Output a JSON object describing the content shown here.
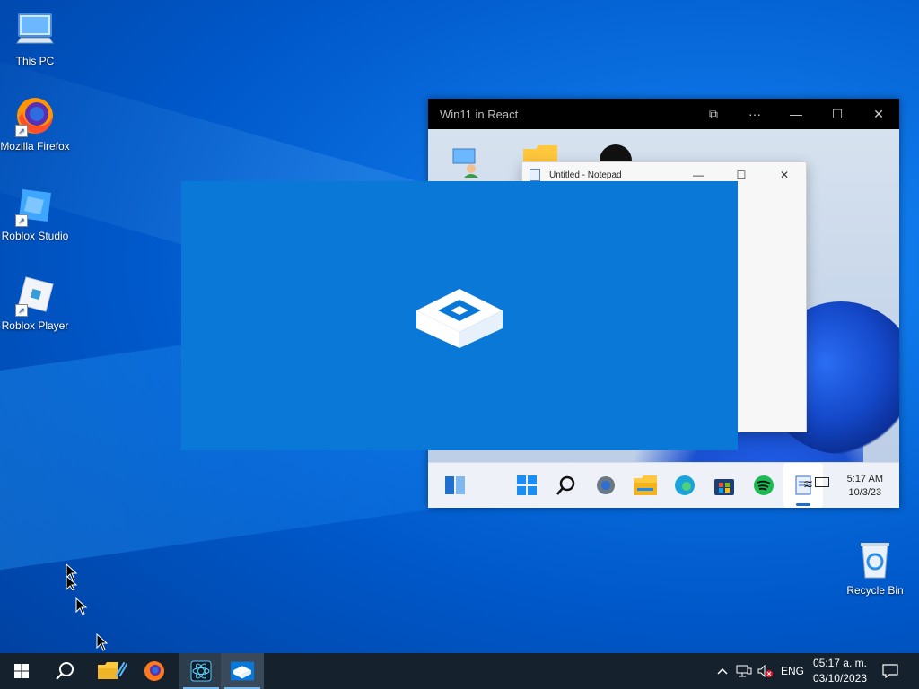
{
  "desktop": {
    "icons": [
      {
        "label": "This PC",
        "icon": "computer-icon"
      },
      {
        "label": "Mozilla Firefox",
        "icon": "firefox-icon"
      },
      {
        "label": "Roblox Studio",
        "icon": "roblox-studio-icon"
      },
      {
        "label": "Roblox Player",
        "icon": "roblox-player-icon"
      },
      {
        "label": "Recycle Bin",
        "icon": "recycle-bin-icon"
      }
    ]
  },
  "react_window": {
    "title": "Win11 in React",
    "buttons": {
      "snap": "⧉",
      "more": "···",
      "minimize": "—",
      "maximize": "☐",
      "close": "✕"
    },
    "notepad": {
      "title": "Untitled - Notepad",
      "minimize": "—",
      "maximize": "☐",
      "close": "✕"
    },
    "taskbar": {
      "time": "5:17 AM",
      "date": "10/3/23",
      "icons": [
        "widgets-icon",
        "start-icon",
        "search-icon",
        "settings-icon",
        "file-explorer-icon",
        "edge-icon",
        "store-icon",
        "spotify-icon",
        "notepad-icon"
      ]
    }
  },
  "splash": {
    "icon": "sandbox-box-icon",
    "color": "#0a78d7"
  },
  "taskbar": {
    "apps": [
      "start-icon",
      "search-icon",
      "file-explorer-icon",
      "firefox-icon",
      "vs-code-react-icon",
      "sandbox-icon"
    ],
    "tray": {
      "language": "ENG",
      "time": "05:17 a. m.",
      "date": "03/10/2023"
    }
  }
}
